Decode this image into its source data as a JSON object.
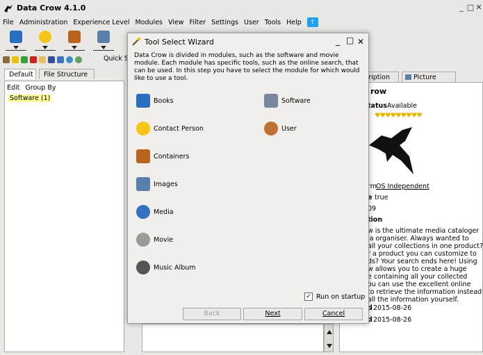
{
  "window": {
    "title": "Data Crow 4.1.0"
  },
  "menubar": {
    "items": [
      "File",
      "Administration",
      "Experience Level",
      "Modules",
      "View",
      "Filter",
      "Settings",
      "User",
      "Tools",
      "Help"
    ]
  },
  "toolbar": {
    "quick_search_label": "Quick S"
  },
  "left_panel": {
    "tabs": [
      "Default",
      "File Structure"
    ],
    "menu": [
      "Edit",
      "Group By"
    ],
    "tree_node": "Software (1)"
  },
  "right_panel": {
    "tabs": [
      "cription",
      "Picture Front"
    ],
    "title_fragment": "row",
    "status_label": "tatus",
    "status_value": "Available",
    "platform_label": "rm",
    "platform_value": "OS Independent",
    "flag_label": "e",
    "flag_value": "true",
    "year_fragment": "09",
    "section_label": "tion",
    "description_lines": [
      "w is the ultimate media cataloger",
      "ia organiser. Always wanted to",
      " all your collections in one product?",
      "r a product you can customize to",
      "ds? Your search ends here! Using",
      "w allows you to create a huge",
      "e containing all your collected",
      "ou can use the excellent online",
      " to retrieve the information instead",
      " all the information yourself."
    ],
    "date1_label": "d",
    "date1_value": "2015-08-26",
    "date2_label": "d",
    "date2_value": "2015-08-26"
  },
  "dialog": {
    "title": "Tool Select Wizard",
    "description": "Data Crow is divided in modules, such as the software and movie module. Each module has specific tools, such as the online search, that can be used. In this step you have to select the module for which would like to use a tool.",
    "modules_left": [
      "Books",
      "Contact Person",
      "Containers",
      "Images",
      "Media",
      "Movie",
      "Music Album"
    ],
    "modules_right": [
      "Software",
      "User"
    ],
    "run_on_startup_label": "Run on startup",
    "run_on_startup_checked": true,
    "back_label": "Back",
    "next_label": "Next",
    "cancel_label": "Cancel"
  },
  "icon_colors": {
    "books": "#2a6fbf",
    "contact": "#f5c518",
    "containers": "#b8641c",
    "images": "#5a7fa8",
    "media": "#3570c0",
    "movie": "#9a9a9a",
    "music": "#555555",
    "software": "#7a86a0",
    "user": "#c07030",
    "twitter": "#1da1f2"
  }
}
